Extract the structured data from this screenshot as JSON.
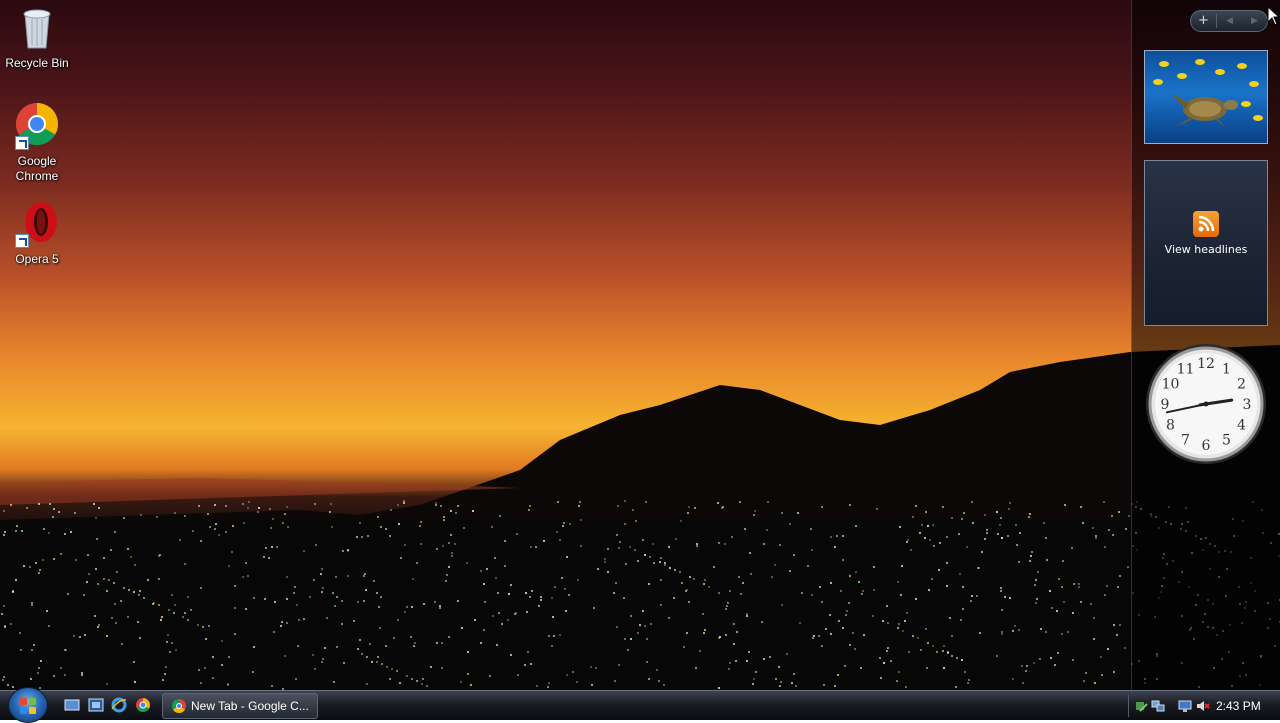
{
  "desktop": {
    "icons": [
      {
        "label": "Recycle Bin"
      },
      {
        "label": "Google Chrome"
      },
      {
        "label": "Opera 5"
      }
    ]
  },
  "sidebar": {
    "controls": {
      "add": "+",
      "prev": "◀",
      "next": "▶"
    },
    "slideshow": {
      "subject": "sea turtle with yellow fish"
    },
    "feed": {
      "label": "View headlines",
      "icon": "rss-icon"
    },
    "clock": {
      "numerals": [
        "12",
        "1",
        "2",
        "3",
        "4",
        "5",
        "6",
        "7",
        "8",
        "9",
        "10",
        "11"
      ],
      "time": "2:43"
    }
  },
  "taskbar": {
    "start": {
      "icon": "windows-logo-icon"
    },
    "quick_launch": [
      "show-desktop-icon",
      "switch-windows-icon",
      "internet-explorer-icon",
      "chrome-icon"
    ],
    "tasks": [
      {
        "label": "New Tab - Google C...",
        "icon": "chrome-icon"
      }
    ],
    "tray": {
      "icons": [
        "safely-remove-icon",
        "network-icon",
        "volume-muted-icon"
      ],
      "time": "2:43 PM"
    }
  },
  "colors": {
    "sky_top": "#2a0a10",
    "horizon": "#f6b430",
    "sidebar_bg": "rgba(0,0,0,0.55)",
    "taskbar_bg": "#1a1d24"
  }
}
